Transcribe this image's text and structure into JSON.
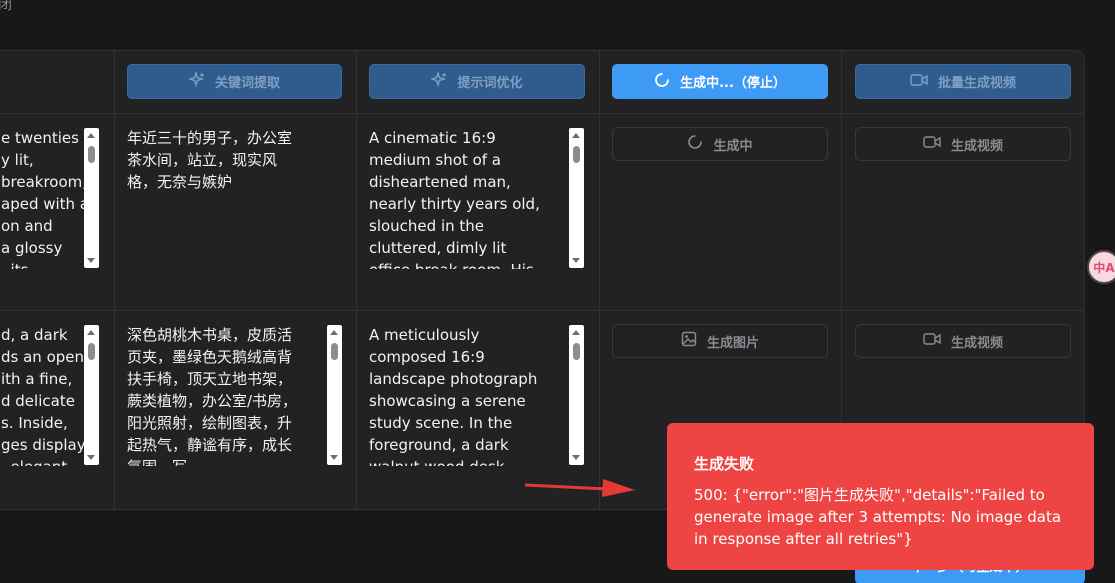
{
  "corner_glyph": "闭",
  "header": {
    "keywords_btn": "关键词提取",
    "prompt_btn": "提示词优化",
    "generating_btn": "生成中...（停止）",
    "batch_video_btn": "批量生成视频"
  },
  "rows": [
    {
      "english_desc": "e twenties\ny lit,\nbreakroom,\naped with a\non and\na glossy\n, its",
      "keywords": "年近三十的男子，办公室茶水间，站立，现实风格，无奈与嫉妒",
      "prompt": "A cinematic 16:9 medium shot of a disheartened man, nearly thirty years old, slouched in the cluttered, dimly lit office break room. His",
      "image_btn": "生成中",
      "video_btn": "生成视频"
    },
    {
      "english_desc": "d, a dark\nds an open\nith a fine,\nd delicate\ns. Inside,\nges display\n, elegant",
      "keywords": "深色胡桃木书桌，皮质活页夹，墨绿色天鹅绒高背扶手椅，顶天立地书架，蕨类植物，办公室/书房，阳光照射，绘制图表，升起热气，静谧有序，成长氛围，写",
      "prompt": "A meticulously composed 16:9 landscape photograph showcasing a serene study scene. In the foreground, a dark walnut wood desk",
      "image_btn": "生成图片",
      "video_btn": "生成视频"
    }
  ],
  "bottom_btn": "下一步（可生成中）",
  "translate_badge": "中A",
  "toast": {
    "title": "生成失败",
    "message": "500: {\"error\":\"图片生成失败\",\"details\":\"Failed to generate image after 3 attempts: No image data in response after all retries\"}"
  },
  "colors": {
    "accent": "#3d9bf5",
    "error": "#ef4444",
    "panel": "#222224",
    "background": "#181818"
  }
}
